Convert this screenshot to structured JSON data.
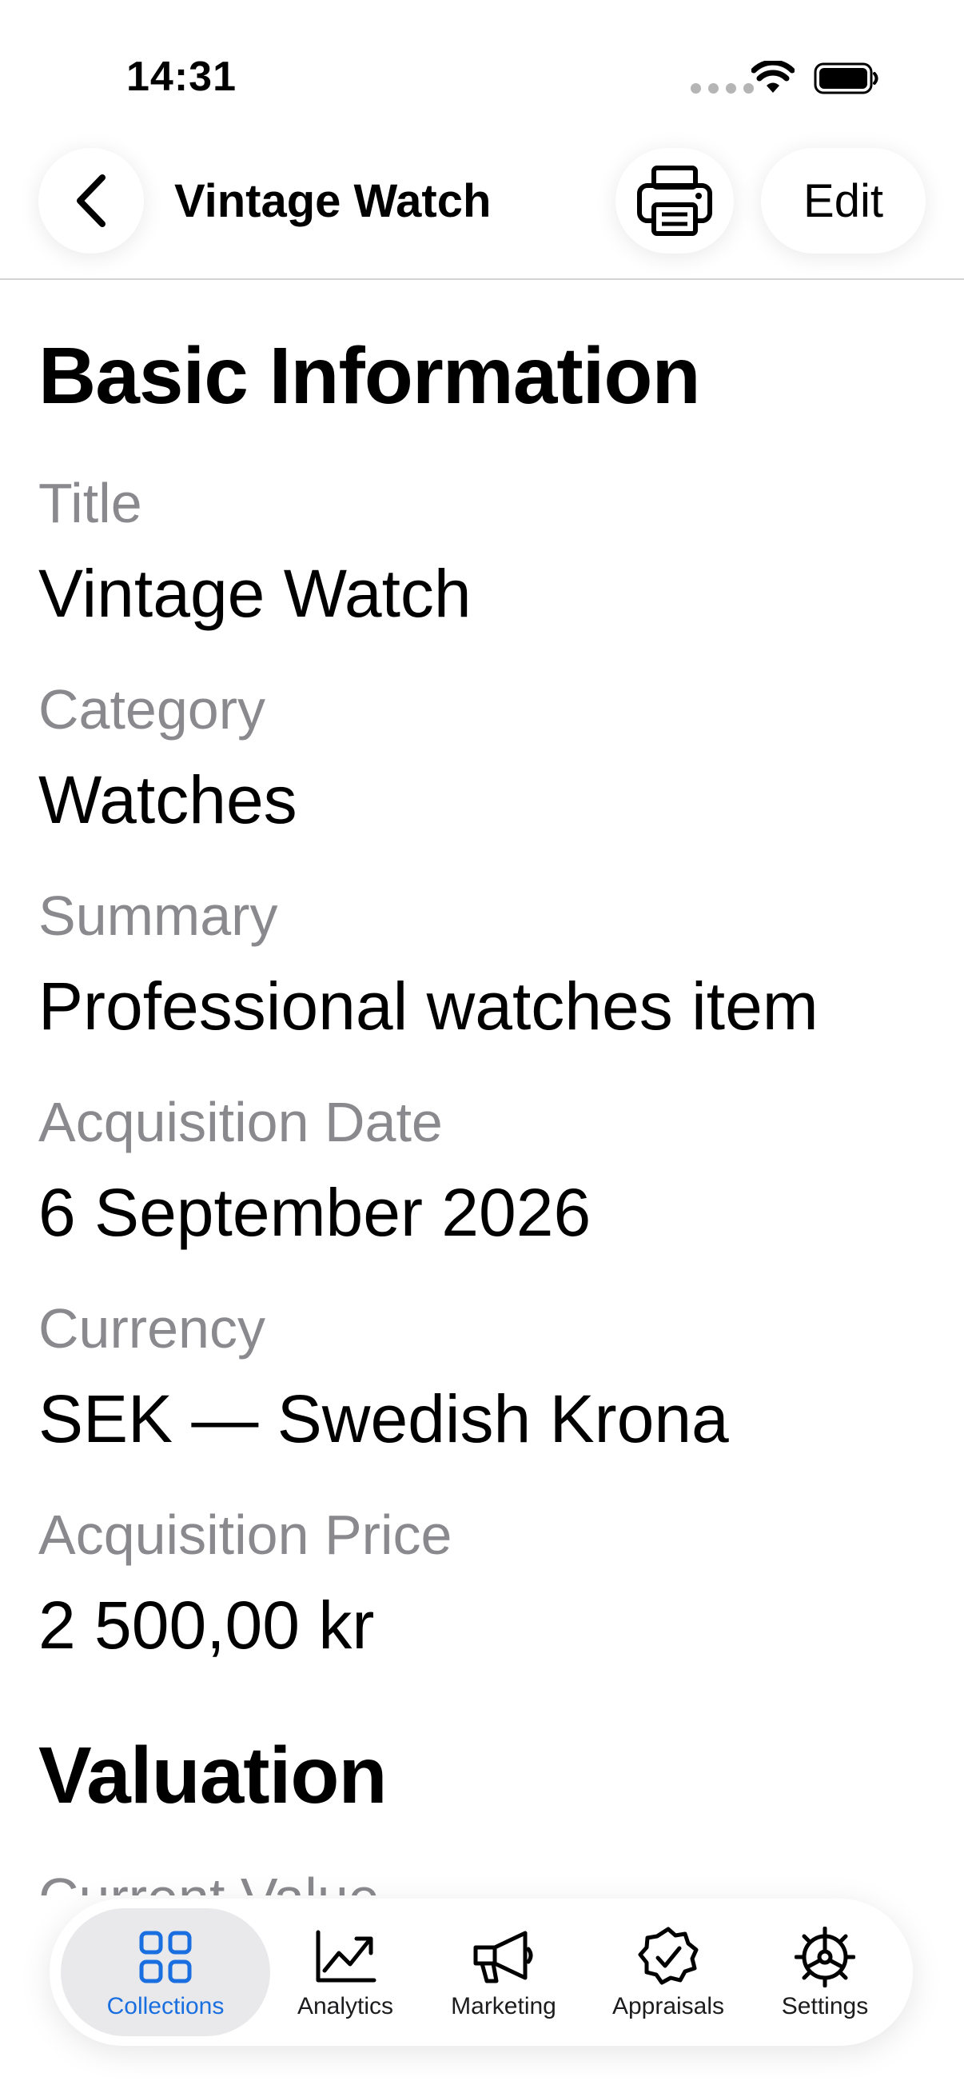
{
  "status": {
    "time": "14:31"
  },
  "nav": {
    "title": "Vintage Watch",
    "edit_label": "Edit"
  },
  "sections": {
    "basic": {
      "header": "Basic Information"
    },
    "valuation": {
      "header": "Valuation"
    }
  },
  "fields": [
    {
      "label": "Title",
      "value": "Vintage Watch"
    },
    {
      "label": "Category",
      "value": "Watches"
    },
    {
      "label": "Summary",
      "value": "Professional watches item"
    },
    {
      "label": "Acquisition Date",
      "value": "6 September 2026"
    },
    {
      "label": "Currency",
      "value": "SEK — Swedish Krona"
    },
    {
      "label": "Acquisition Price",
      "value": "2 500,00 kr"
    }
  ],
  "valuation_fields": [
    {
      "label": "Current Value"
    }
  ],
  "tabs": [
    {
      "label": "Collections",
      "icon": "grid-icon",
      "active": true
    },
    {
      "label": "Analytics",
      "icon": "chart-up-icon"
    },
    {
      "label": "Marketing",
      "icon": "megaphone-icon"
    },
    {
      "label": "Appraisals",
      "icon": "checkmark-seal-icon"
    },
    {
      "label": "Settings",
      "icon": "gear-icon"
    }
  ],
  "colors": {
    "accent": "#1a6fe0",
    "label_gray": "#8a8a8e"
  }
}
